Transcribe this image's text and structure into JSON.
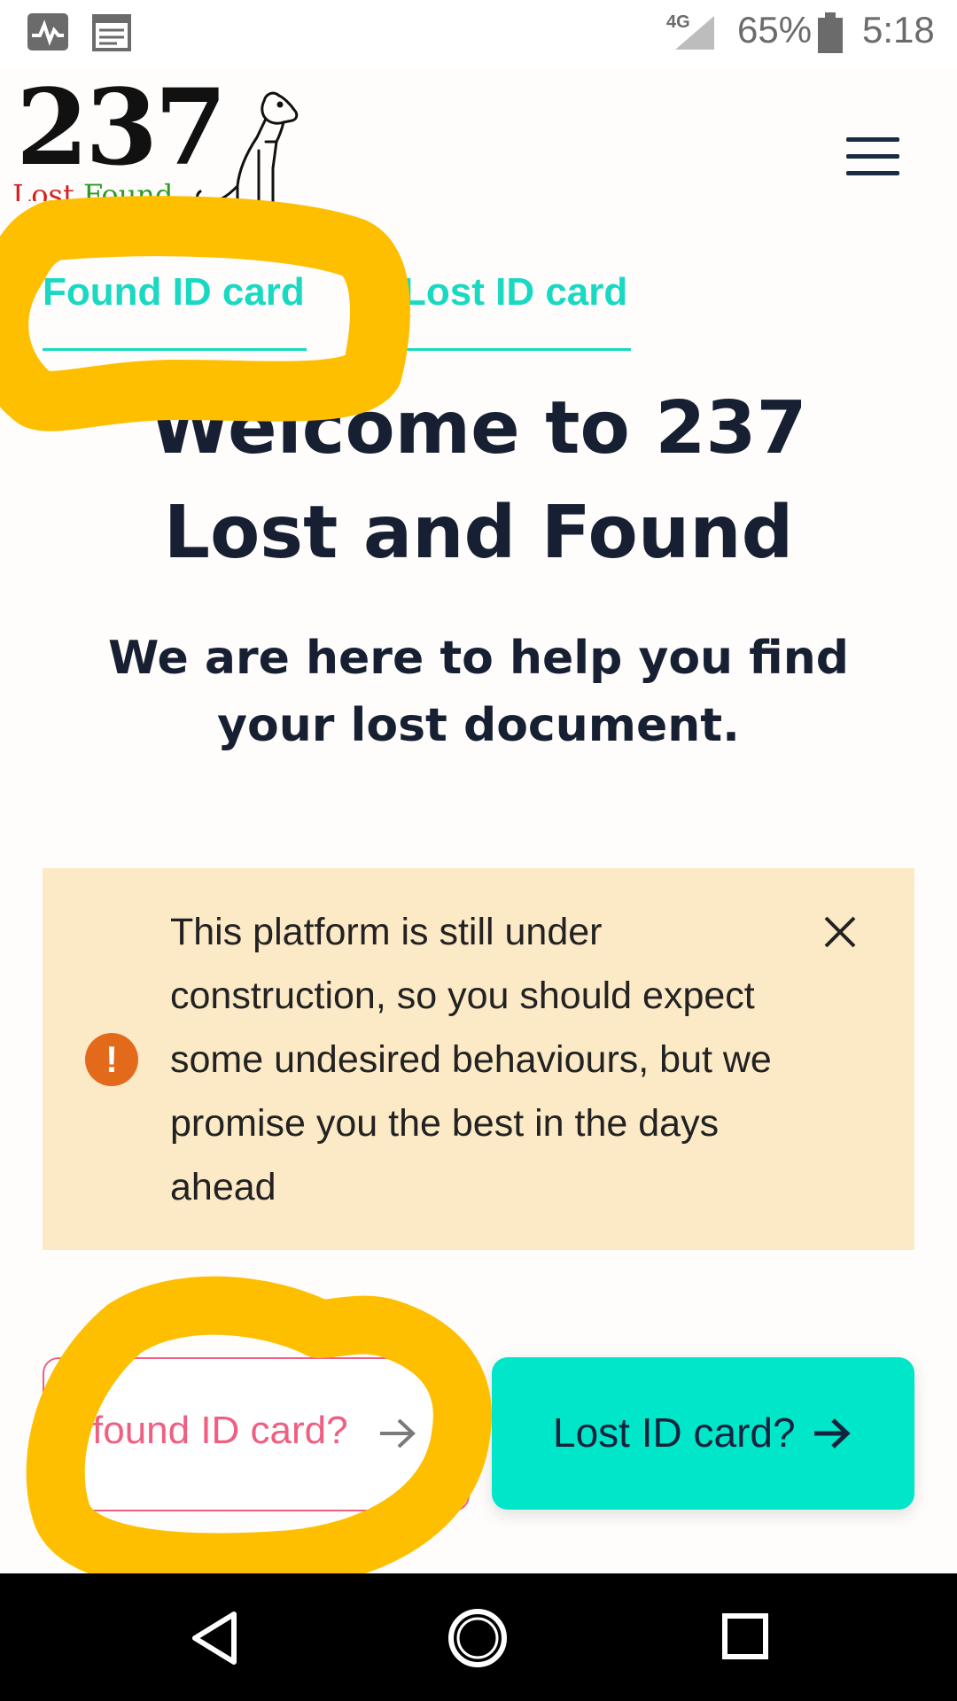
{
  "status_bar": {
    "network": "4G",
    "battery": "65%",
    "time": "5:18",
    "icons": [
      "activity-icon",
      "calendar-icon",
      "signal-icon",
      "battery-icon"
    ]
  },
  "header": {
    "logo_number": "237",
    "logo_sub_lost": "Lost",
    "logo_sub_found": "Found",
    "logo_icon": "dog-icon",
    "menu_icon": "hamburger-menu-icon"
  },
  "tabs": [
    {
      "label": "Found ID card"
    },
    {
      "label": "Lost ID card"
    }
  ],
  "main": {
    "title": "Welcome to 237 Lost and Found",
    "subtitle": "We are here to help you find your lost document."
  },
  "alert": {
    "message": "This platform is still under construction, so you should expect some undesired behaviours, but we promise you the best in the days ahead",
    "icon": "exclamation-icon",
    "close_icon": "close-icon"
  },
  "buttons": {
    "found_label": "found ID card?",
    "lost_label": "Lost ID card?"
  },
  "colors": {
    "accent": "#19d9c2",
    "button_teal": "#00e6c9",
    "found_pink": "#ef5f82",
    "alert_bg": "#fce9c6",
    "alert_icon": "#e36a1b",
    "marker_yellow": "#fdbf00"
  },
  "nav_bar": {
    "icons": [
      "back-icon",
      "home-icon",
      "recents-icon"
    ]
  }
}
